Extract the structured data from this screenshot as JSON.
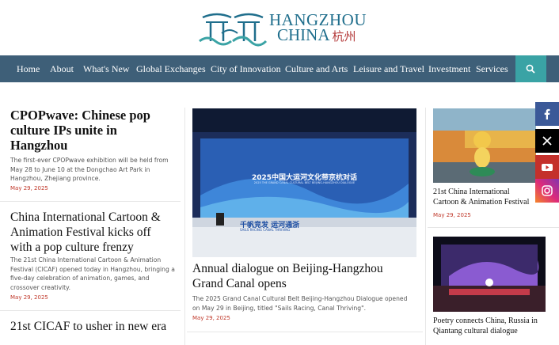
{
  "logo": {
    "line1": "HANGZHOU",
    "line2": "CHINA",
    "cn": "杭州"
  },
  "nav": {
    "items": [
      "Home",
      "About",
      "What's New",
      "Global Exchanges",
      "City of Innovation",
      "Culture and Arts",
      "Leisure and Travel",
      "Investment",
      "Services"
    ]
  },
  "left": {
    "a1": {
      "title": "CPOPwave: Chinese pop culture IPs unite in Hangzhou",
      "excerpt": "The first-ever CPOPwave exhibition will be held from May 28 to June 10 at the Dongchao Art Park in Hangzhou, Zhejiang province.",
      "date": "May 29, 2025"
    },
    "a2": {
      "title": "China International Cartoon & Animation Festival kicks off with a pop culture frenzy",
      "excerpt": "The 21st China International Cartoon & Animation Festival (CICAF) opened today in Hangzhou, bringing a five-day celebration of animation, games, and crossover creativity.",
      "date": "May 29, 2025"
    },
    "a3": {
      "title": "21st CICAF to usher in new era"
    }
  },
  "center": {
    "image": {
      "banner_cn": "2025中国大运河文化带京杭对话",
      "banner_en": "2025 THE GRAND CANAL CULTURAL BELT BEIJING-HANGZHOU DIALOGUE",
      "lower_cn": "千帆竞发 运河通浙",
      "lower_en": "SAILS RACING CANAL THRIVING"
    },
    "title": "Annual dialogue on Beijing-Hangzhou Grand Canal opens",
    "excerpt": "The 2025 Grand Canal Cultural Belt Beijing-Hangzhou Dialogue opened on May 29 in Beijing, titled \"Sails Racing, Canal Thriving\".",
    "date": "May 29, 2025"
  },
  "right": {
    "a1": {
      "title": "21st China International Cartoon & Animation Festival",
      "date": "May 29, 2025"
    },
    "a2": {
      "title": "Poetry connects China, Russia in Qiantang cultural dialogue"
    }
  },
  "social": [
    "facebook-icon",
    "x-icon",
    "youtube-icon",
    "instagram-icon"
  ],
  "colors": {
    "nav": "#3e5f78",
    "search": "#3aa3a5",
    "date": "#c0392b",
    "logo": "#1f6e8c"
  }
}
